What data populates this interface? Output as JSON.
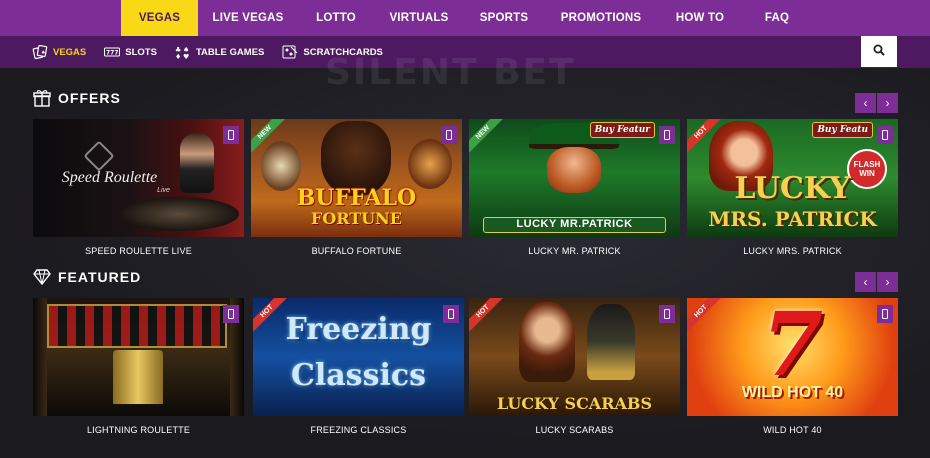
{
  "top_nav": [
    {
      "label": "VEGAS",
      "active": true
    },
    {
      "label": "LIVE VEGAS",
      "active": false
    },
    {
      "label": "LOTTO",
      "active": false
    },
    {
      "label": "VIRTUALS",
      "active": false
    },
    {
      "label": "SPORTS",
      "active": false
    },
    {
      "label": "PROMOTIONS",
      "active": false
    },
    {
      "label": "HOW TO",
      "active": false
    },
    {
      "label": "FAQ",
      "active": false
    }
  ],
  "sub_nav": [
    {
      "label": "VEGAS",
      "icon": "cards-icon",
      "active": true
    },
    {
      "label": "SLOTS",
      "icon": "slots-777-icon",
      "active": false
    },
    {
      "label": "TABLE GAMES",
      "icon": "chips-icon",
      "active": false
    },
    {
      "label": "SCRATCHCARDS",
      "icon": "scratchcard-icon",
      "active": false
    }
  ],
  "watermark": "SILENT BET",
  "offers": {
    "title": "OFFERS",
    "icon": "gift-icon",
    "games": [
      {
        "name": "SPEED ROULETTE LIVE",
        "art_title": "Speed Roulette",
        "art_sub": "Live",
        "badge": "",
        "buy_feature": ""
      },
      {
        "name": "BUFFALO FORTUNE",
        "art_title": "BUFFALO",
        "art_sub": "FORTUNE",
        "badge": "NEW",
        "buy_feature": ""
      },
      {
        "name": "LUCKY MR. PATRICK",
        "art_title": "LUCKY MR.PATRICK",
        "art_sub": "",
        "badge": "NEW",
        "buy_feature": "Buy Featur"
      },
      {
        "name": "LUCKY MRS. PATRICK",
        "art_title": "LUCKY",
        "art_sub": "MRS. PATRICK",
        "badge": "HOT",
        "buy_feature": "Buy Featu",
        "extra": "FLASH WIN"
      }
    ]
  },
  "featured": {
    "title": "FEATURED",
    "icon": "diamond-icon",
    "games": [
      {
        "name": "LIGHTNING ROULETTE",
        "art_title": "",
        "art_sub": "",
        "badge": ""
      },
      {
        "name": "FREEZING CLASSICS",
        "art_title": "Freezing",
        "art_sub": "Classics",
        "badge": "HOT"
      },
      {
        "name": "LUCKY SCARABS",
        "art_title": "LUCKY SCARABS",
        "art_sub": "",
        "badge": "HOT"
      },
      {
        "name": "WILD HOT 40",
        "art_title": "7",
        "art_sub": "WILD HOT 40",
        "badge": "HOT"
      }
    ]
  },
  "arrows": {
    "prev": "‹",
    "next": "›"
  },
  "colors": {
    "purple": "#7d2e96",
    "dark_purple": "#4d1a61",
    "yellow": "#f9d816",
    "background": "#1b1a1f"
  }
}
